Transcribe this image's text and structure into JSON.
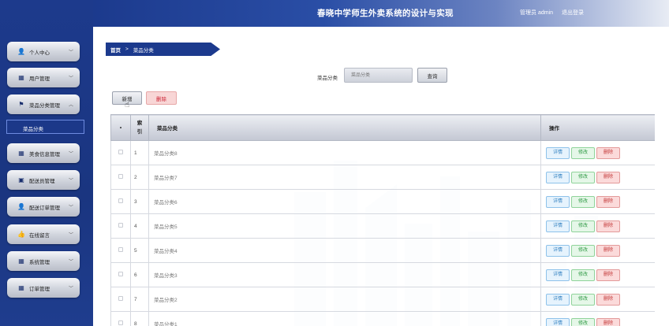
{
  "header": {
    "title": "春晓中学师生外卖系统的设计与实现",
    "user": "管理员 admin",
    "logout": "退出登录"
  },
  "sidebar": {
    "items": [
      {
        "label": "个人中心",
        "icon": "person-icon",
        "glyph": "👤",
        "expanded": false
      },
      {
        "label": "用户管理",
        "icon": "grid-icon",
        "glyph": "▦",
        "expanded": false
      },
      {
        "label": "菜品分类管理",
        "icon": "flag-icon",
        "glyph": "⚑",
        "expanded": true
      },
      {
        "label": "美食信息管理",
        "icon": "grid-icon",
        "glyph": "▦",
        "expanded": false
      },
      {
        "label": "配送员管理",
        "icon": "calendar-icon",
        "glyph": "▣",
        "expanded": false
      },
      {
        "label": "配送订单管理",
        "icon": "person-icon",
        "glyph": "👤",
        "expanded": false
      },
      {
        "label": "在线留言",
        "icon": "thumbs-up-icon",
        "glyph": "👍",
        "expanded": false
      },
      {
        "label": "系统管理",
        "icon": "apps-icon",
        "glyph": "▦",
        "expanded": false
      },
      {
        "label": "订单管理",
        "icon": "grid-icon",
        "glyph": "▦",
        "expanded": false
      }
    ],
    "submenu_active": "菜品分类"
  },
  "breadcrumb": {
    "home": "首页",
    "separator": ">",
    "current": "菜品分类"
  },
  "search": {
    "label": "菜品分类",
    "placeholder": "菜品分类",
    "button": "查询"
  },
  "actions": {
    "add": "新增",
    "delete": "删除"
  },
  "table": {
    "headers": {
      "select": "•",
      "index": "索引",
      "category": "菜品分类",
      "operations": "操作"
    },
    "rows": [
      {
        "index": "1",
        "category": "菜品分类8"
      },
      {
        "index": "2",
        "category": "菜品分类7"
      },
      {
        "index": "3",
        "category": "菜品分类6"
      },
      {
        "index": "4",
        "category": "菜品分类5"
      },
      {
        "index": "5",
        "category": "菜品分类4"
      },
      {
        "index": "6",
        "category": "菜品分类3"
      },
      {
        "index": "7",
        "category": "菜品分类2"
      },
      {
        "index": "8",
        "category": "菜品分类1"
      }
    ],
    "row_actions": {
      "detail": "详情",
      "edit": "修改",
      "remove": "删除"
    }
  },
  "colors": {
    "sidebar": "#1d3a8c",
    "accent": "#1c3a8d",
    "danger": "#c23535",
    "success": "#2f9a45",
    "info": "#2f7fc0"
  }
}
